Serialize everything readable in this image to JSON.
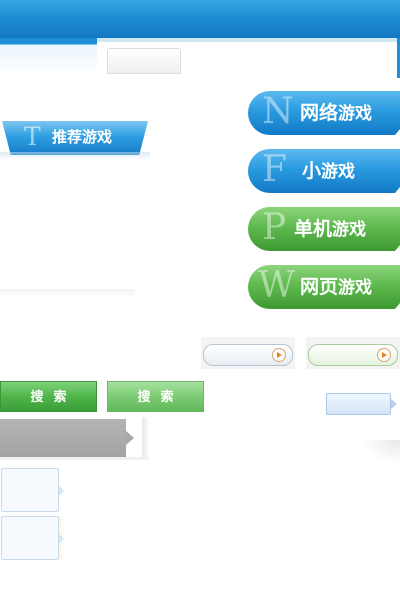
{
  "recommend": {
    "letter": "T",
    "label": "推荐游戏"
  },
  "categories": [
    {
      "letter": "N",
      "label": "网络",
      "suffix": "游戏",
      "color": "#2a9be0"
    },
    {
      "letter": "F",
      "label": "小",
      "suffix": "游戏",
      "color": "#2a9be0"
    },
    {
      "letter": "P",
      "label": "单机",
      "suffix": "游戏",
      "color": "#5fba4f"
    },
    {
      "letter": "W",
      "label": "网页",
      "suffix": "游戏",
      "color": "#5fba4f"
    }
  ],
  "search": {
    "label_primary": "搜索",
    "label_secondary": "搜索"
  },
  "colors": {
    "top_bar": "#1f8ed3",
    "accent_orange": "#e8841c",
    "search_green": "#4fb64a"
  },
  "icons": {
    "pill_play": "play-arrow-icon"
  }
}
